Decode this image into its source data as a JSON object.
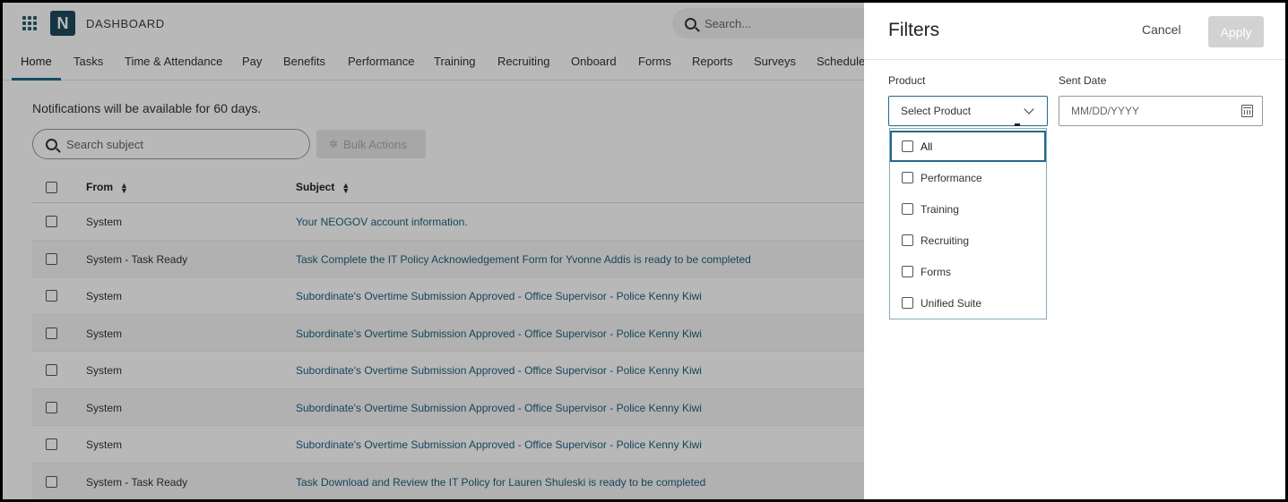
{
  "topbar": {
    "app_title": "DASHBOARD",
    "logo_letter": "N",
    "search_placeholder": "Search..."
  },
  "nav": {
    "items": [
      "Home",
      "Tasks",
      "Time & Attendance",
      "Pay",
      "Benefits",
      "Performance",
      "Training",
      "Recruiting",
      "Onboard",
      "Forms",
      "Reports",
      "Surveys",
      "Schedule"
    ],
    "active": "Home"
  },
  "main": {
    "notice": "Notifications will be available for 60 days.",
    "search_placeholder": "Search subject",
    "bulk_actions_label": "Bulk Actions",
    "columns": [
      "From",
      "Subject"
    ],
    "rows": [
      {
        "from": "System",
        "subject": "Your NEOGOV account information."
      },
      {
        "from": "System - Task Ready",
        "subject": "Task Complete the IT Policy Acknowledgement Form for Yvonne Addis is ready to be completed"
      },
      {
        "from": "System",
        "subject": "Subordinate's Overtime Submission Approved - Office Supervisor - Police Kenny Kiwi"
      },
      {
        "from": "System",
        "subject": "Subordinate's Overtime Submission Approved - Office Supervisor - Police Kenny Kiwi"
      },
      {
        "from": "System",
        "subject": "Subordinate's Overtime Submission Approved - Office Supervisor - Police Kenny Kiwi"
      },
      {
        "from": "System",
        "subject": "Subordinate's Overtime Submission Approved - Office Supervisor - Police Kenny Kiwi"
      },
      {
        "from": "System",
        "subject": "Subordinate's Overtime Submission Approved - Office Supervisor - Police Kenny Kiwi"
      },
      {
        "from": "System - Task Ready",
        "subject": "Task Download and Review the IT Policy for Lauren Shuleski is ready to be completed"
      }
    ]
  },
  "filters": {
    "title": "Filters",
    "cancel_label": "Cancel",
    "apply_label": "Apply",
    "product_label": "Product",
    "product_placeholder": "Select Product",
    "sent_date_label": "Sent Date",
    "sent_date_placeholder": "MM/DD/YYYY",
    "product_options": [
      "All",
      "Performance",
      "Training",
      "Recruiting",
      "Forms",
      "Unified Suite"
    ]
  },
  "colors": {
    "accent": "#1f6a8a",
    "link": "#1f5f7f",
    "logo_bg": "#1f4a5e",
    "apply_disabled": "#d2d2d2"
  },
  "icons": [
    "apps-grid-icon",
    "search-icon",
    "sort-icon",
    "chevron-down-icon",
    "calendar-icon",
    "sparkle-icon"
  ]
}
